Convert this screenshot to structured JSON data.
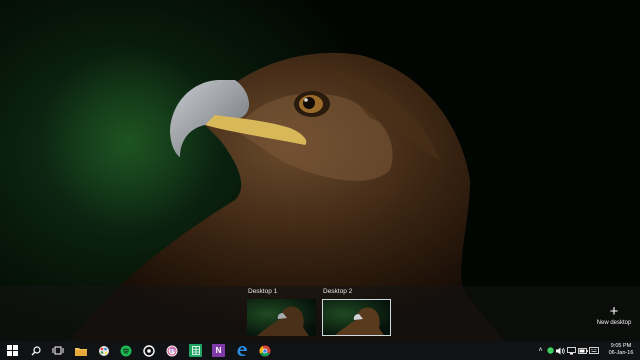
{
  "task_view": {
    "desktops": [
      {
        "label": "Desktop 1",
        "active": false
      },
      {
        "label": "Desktop 2",
        "active": true
      }
    ],
    "new_desktop_label": "New desktop",
    "new_desktop_icon": "plus-icon"
  },
  "taskbar": {
    "pinned": [
      {
        "name": "start-button",
        "icon": "windows-logo-icon"
      },
      {
        "name": "search-button",
        "icon": "search-icon"
      },
      {
        "name": "task-view-button",
        "icon": "task-view-icon"
      },
      {
        "name": "file-explorer-button",
        "icon": "folder-icon"
      },
      {
        "name": "paint-button",
        "icon": "paint-icon"
      },
      {
        "name": "spotify-button",
        "icon": "spotify-icon"
      },
      {
        "name": "media-player-button",
        "icon": "media-player-icon"
      },
      {
        "name": "itunes-button",
        "icon": "itunes-icon"
      },
      {
        "name": "sheets-button",
        "icon": "sheets-icon"
      },
      {
        "name": "onenote-button",
        "icon": "onenote-icon",
        "letter": "N"
      },
      {
        "name": "edge-button",
        "icon": "edge-icon"
      },
      {
        "name": "chrome-button",
        "icon": "chrome-icon"
      }
    ],
    "tray_icons": [
      "chevron-up-icon",
      "status-icon",
      "volume-icon",
      "network-icon",
      "battery-icon",
      "keyboard-icon"
    ],
    "clock": {
      "time": "9:05 PM",
      "date": "06-Jan-16"
    },
    "notification_icon": "action-center-icon"
  },
  "colors": {
    "taskbar": "#101214",
    "accent": "#0078d7"
  }
}
